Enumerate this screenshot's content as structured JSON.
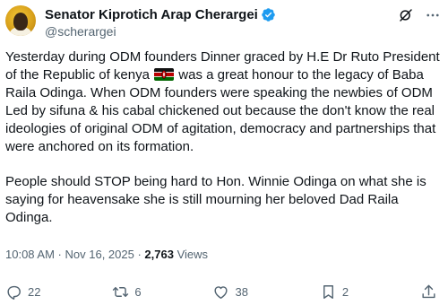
{
  "author": {
    "display_name": "Senator Kiprotich Arap Cherargei",
    "handle": "@scherargei",
    "verified": true
  },
  "header_icons": [
    "grok-icon",
    "more-icon"
  ],
  "post": {
    "paragraph_1_before_flag": "Yesterday during ODM founders Dinner graced by H.E Dr Ruto President of the Republic of kenya ",
    "paragraph_1_flag": "kenya-flag-emoji",
    "paragraph_1_after_flag": " was a great honour to the legacy of Baba Raila Odinga. When ODM founders were speaking the newbies of ODM Led by sifuna & his cabal chickened out because the don't know the real ideologies of original ODM of agitation, democracy and partnerships that were anchored on its formation.",
    "paragraph_2": "People should STOP being hard to Hon. Winnie Odinga on what she is saying for heavensake she is still mourning her beloved Dad Raila Odinga."
  },
  "meta": {
    "time": "10:08 AM",
    "separator_1": " · ",
    "date": "Nov 16, 2025",
    "separator_2": " · ",
    "views_count": "2,763",
    "views_label": " Views"
  },
  "actions": {
    "replies": "22",
    "reposts": "6",
    "likes": "38",
    "bookmarks": "2"
  },
  "colors": {
    "text": "#0f1419",
    "secondary": "#536471",
    "verified": "#1d9bf0"
  }
}
